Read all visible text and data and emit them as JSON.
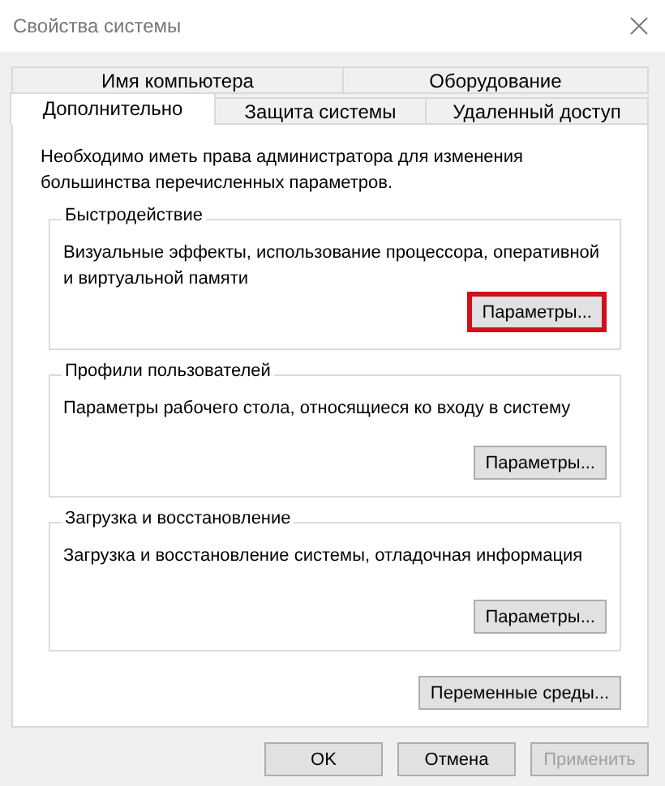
{
  "window": {
    "title": "Свойства системы"
  },
  "tab_rows": [
    [
      {
        "label": "Имя компьютера",
        "selected": false
      },
      {
        "label": "Оборудование",
        "selected": false
      }
    ],
    [
      {
        "label": "Дополнительно",
        "selected": true
      },
      {
        "label": "Защита системы",
        "selected": false
      },
      {
        "label": "Удаленный доступ",
        "selected": false
      }
    ]
  ],
  "notice": "Необходимо иметь права администратора для изменения большинства перечисленных параметров.",
  "groups": [
    {
      "title": "Быстродействие",
      "description": "Визуальные эффекты, использование процессора, оперативной и виртуальной памяти",
      "button": {
        "label": "Параметры...",
        "highlighted": true
      }
    },
    {
      "title": "Профили пользователей",
      "description": "Параметры рабочего стола, относящиеся ко входу в систему",
      "button": {
        "label": "Параметры...",
        "highlighted": false
      }
    },
    {
      "title": "Загрузка и восстановление",
      "description": "Загрузка и восстановление системы, отладочная информация",
      "button": {
        "label": "Параметры...",
        "highlighted": false
      }
    }
  ],
  "env_button": {
    "label": "Переменные среды..."
  },
  "buttons": [
    {
      "label": "OK",
      "disabled": false
    },
    {
      "label": "Отмена",
      "disabled": false
    },
    {
      "label": "Применить",
      "disabled": true
    }
  ]
}
